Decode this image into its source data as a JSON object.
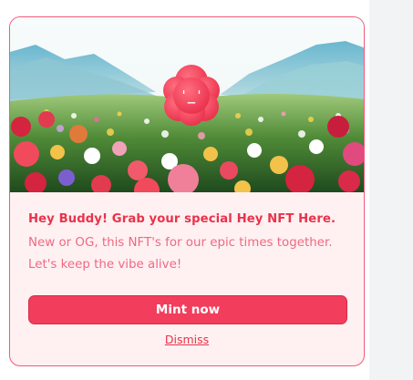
{
  "card": {
    "mascot_face": "ˈ_ˈ",
    "headline": "Hey Buddy! Grab your special Hey NFT Here.",
    "body": "New or OG, this NFT's for our epic times together. Let's keep the vibe alive!",
    "mint_label": "Mint now",
    "dismiss_label": "Dismiss"
  },
  "colors": {
    "accent": "#f23d5c",
    "headline": "#e8334a",
    "body_text": "#ee6a80",
    "card_bg": "#fff0f2",
    "border": "#f35a7a"
  },
  "icons": {
    "mascot": "pink-flower-mascot-icon"
  }
}
